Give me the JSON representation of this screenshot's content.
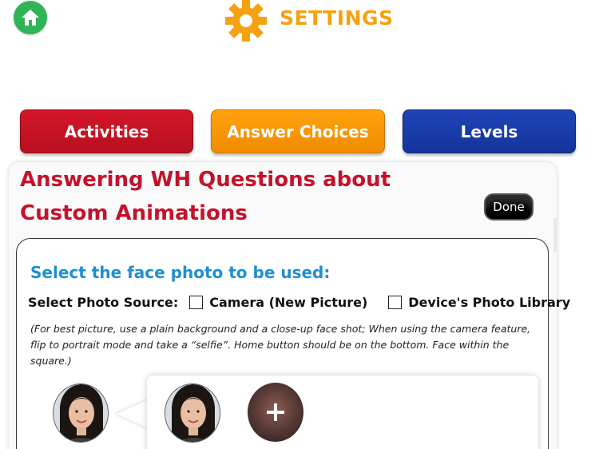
{
  "header": {
    "title": "SETTINGS",
    "home_icon": "home-icon",
    "gear_icon": "gear-icon",
    "accent": "#f6a10f"
  },
  "tabs": [
    {
      "label": "Activities",
      "color": "#c5122b"
    },
    {
      "label": "Answer Choices",
      "color": "#f7950b"
    },
    {
      "label": "Levels",
      "color": "#163b9e"
    }
  ],
  "panel": {
    "title_line1": "Answering WH Questions about",
    "title_line2": "Custom Animations",
    "done_label": "Done"
  },
  "photo_section": {
    "heading": "Select the face photo to be used:",
    "source_label": "Select Photo Source:",
    "options": [
      {
        "label": "Camera (New Picture)",
        "checked": false
      },
      {
        "label": "Device's Photo Library",
        "checked": false
      }
    ],
    "note": "(For best picture, use a plain background and a close-up face shot; When using the camera feature, flip to portrait mode and take a “selfie”. Home button should be on the bottom. Face within the square.)",
    "add_icon": "plus-icon"
  }
}
